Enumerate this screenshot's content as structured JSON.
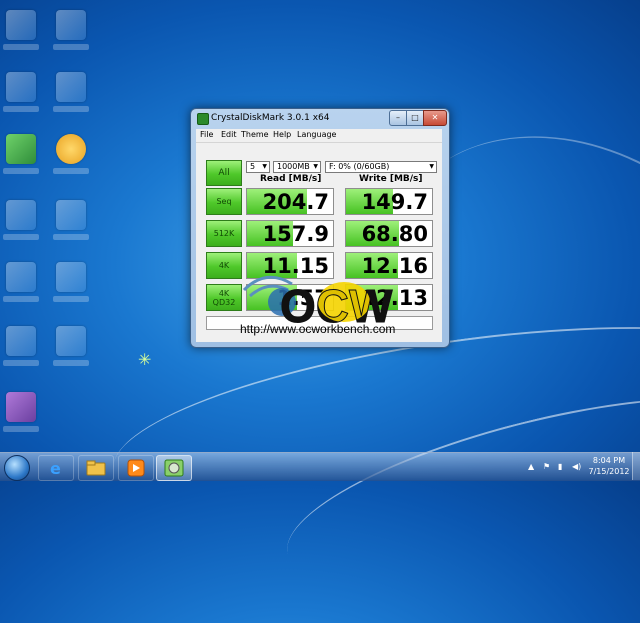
{
  "window": {
    "title": "CrystalDiskMark 3.0.1 x64",
    "controls": {
      "minimize": "–",
      "maximize": "□",
      "close": "✕"
    }
  },
  "menu": [
    "File",
    "Edit",
    "Theme",
    "Help",
    "Language"
  ],
  "toolbar": {
    "all_label": "All",
    "runs": "5",
    "size": "1000MB",
    "drive": "F: 0% (0/60GB)"
  },
  "headers": {
    "read": "Read [MB/s]",
    "write": "Write [MB/s]"
  },
  "tests": [
    {
      "label": "Seq",
      "label2": "",
      "read": "204.7",
      "write": "149.7",
      "read_fill": 0.7,
      "write_fill": 0.55
    },
    {
      "label": "512K",
      "label2": "",
      "read": "157.9",
      "write": "68.80",
      "read_fill": 0.53,
      "write_fill": 0.62
    },
    {
      "label": "4K",
      "label2": "",
      "read": "11.15",
      "write": "12.16",
      "read_fill": 0.58,
      "write_fill": 0.6
    },
    {
      "label": "4K",
      "label2": "QD32",
      "read": "1.57",
      "write": "12.13",
      "read_fill": 0.58,
      "write_fill": 0.6
    }
  ],
  "watermark": {
    "logo": "OCW",
    "url": "http://www.ocworkbench.com"
  },
  "taskbar": {
    "time": "8:04 PM",
    "date": "7/15/2012"
  },
  "icons": {
    "start": "windows-start-orb",
    "ie": "internet-explorer-icon",
    "explorer": "folder-icon",
    "media": "media-player-icon",
    "cdm": "crystaldiskmark-icon"
  },
  "colors": {
    "accent_green": "#4fc82a",
    "desktop_blue": "#1a78d0"
  }
}
